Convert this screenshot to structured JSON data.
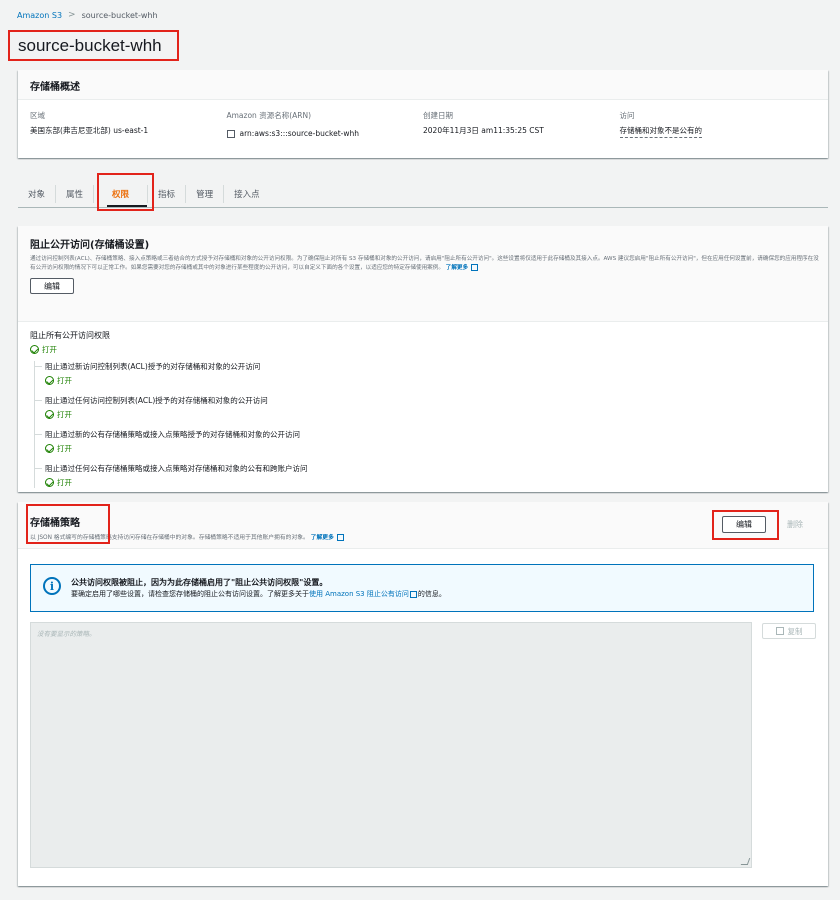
{
  "breadcrumb": {
    "root": "Amazon S3",
    "separator": ">",
    "current": "source-bucket-whh"
  },
  "page_title": "source-bucket-whh",
  "overview": {
    "heading": "存储桶概述",
    "region_label": "区域",
    "region_value": "美国东部(弗吉尼亚北部) us-east-1",
    "arn_label": "Amazon 资源名称(ARN)",
    "arn_value": "arn:aws:s3:::source-bucket-whh",
    "created_label": "创建日期",
    "created_value": "2020年11月3日 am11:35:25 CST",
    "access_label": "访问",
    "access_value": "存储桶和对象不是公有的"
  },
  "tabs": [
    "对象",
    "属性",
    "权限",
    "指标",
    "管理",
    "接入点"
  ],
  "active_tab": "权限",
  "block_public_access": {
    "title": "阻止公开访问(存储桶设置)",
    "description": "通过访问控制列表(ACL)、存储桶策略、接入点策略或三者结合的方式授予对存储桶和对象的公开访问权限。为了确保阻止对所有 S3 存储桶和对象的公开访问，请启用\"阻止所有公开访问\"。这些设置将仅适用于此存储桶及其接入点。AWS 建议您启用\"阻止所有公开访问\"，但在应用任何设置前，请确保您的应用程序在没有公开访问权限的情况下可以正常工作。如果您需要对您的存储桶或其中的对象进行某些程度的公开访问，可以自定义下面的各个设置，以适应您的特定存储使用案例。",
    "learn_more": "了解更多",
    "edit_label": "编辑",
    "main_setting": "阻止所有公开访问权限",
    "main_status": "打开",
    "sub_settings": [
      {
        "label": "阻止通过新访问控制列表(ACL)授予的对存储桶和对象的公开访问",
        "status": "打开"
      },
      {
        "label": "阻止通过任何访问控制列表(ACL)授予的对存储桶和对象的公开访问",
        "status": "打开"
      },
      {
        "label": "阻止通过新的公有存储桶策略或接入点策略授予的对存储桶和对象的公开访问",
        "status": "打开"
      },
      {
        "label": "阻止通过任何公有存储桶策略或接入点策略对存储桶和对象的公有和跨账户访问",
        "status": "打开"
      }
    ]
  },
  "bucket_policy": {
    "title": "存储桶策略",
    "description": "以 JSON 格式编写的存储桶策略支持访问存储在存储桶中的对象。存储桶策略不适用于其他账户拥有的对象。",
    "learn_more": "了解更多",
    "edit_label": "编辑",
    "delete_label": "删除",
    "info_title": "公共访问权限被阻止，因为为此存储桶启用了\"阻止公共访问权限\"设置。",
    "info_text_prefix": "要确定启用了哪些设置，请检查您存储桶的阻止公有访问设置。了解更多关于",
    "info_link": "使用 Amazon S3 阻止公有访问",
    "info_text_suffix": "的信息。",
    "editor_placeholder": "没有要显示的策略。",
    "copy_label": "复制"
  },
  "colors": {
    "link": "#0073bb",
    "active_tab": "#ec7211",
    "success": "#1d8102",
    "highlight_box": "#e2231a"
  }
}
